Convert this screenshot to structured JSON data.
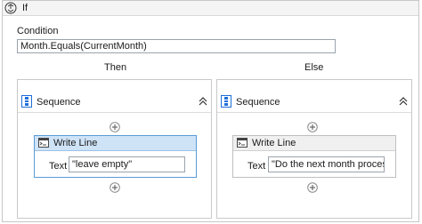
{
  "if_activity": {
    "title": "If",
    "condition_label": "Condition",
    "condition_value": "Month.Equals(CurrentMonth)",
    "then_label": "Then",
    "else_label": "Else"
  },
  "then_branch": {
    "sequence_title": "Sequence",
    "write_line": {
      "title": "Write Line",
      "text_label": "Text",
      "text_value": "\"leave empty\""
    }
  },
  "else_branch": {
    "sequence_title": "Sequence",
    "write_line": {
      "title": "Write Line",
      "text_label": "Text",
      "text_value": "\"Do the next month process\""
    }
  },
  "icons": {
    "if": "if-activity-icon",
    "sequence": "sequence-icon",
    "collapse": "collapse-chevrons-up-icon",
    "add": "add-activity-plus-icon",
    "write_line": "write-line-icon"
  },
  "colors": {
    "selected_border": "#5b9bd5",
    "selected_header": "#cfe3f7",
    "sequence_icon_blue": "#1e6fd9"
  }
}
